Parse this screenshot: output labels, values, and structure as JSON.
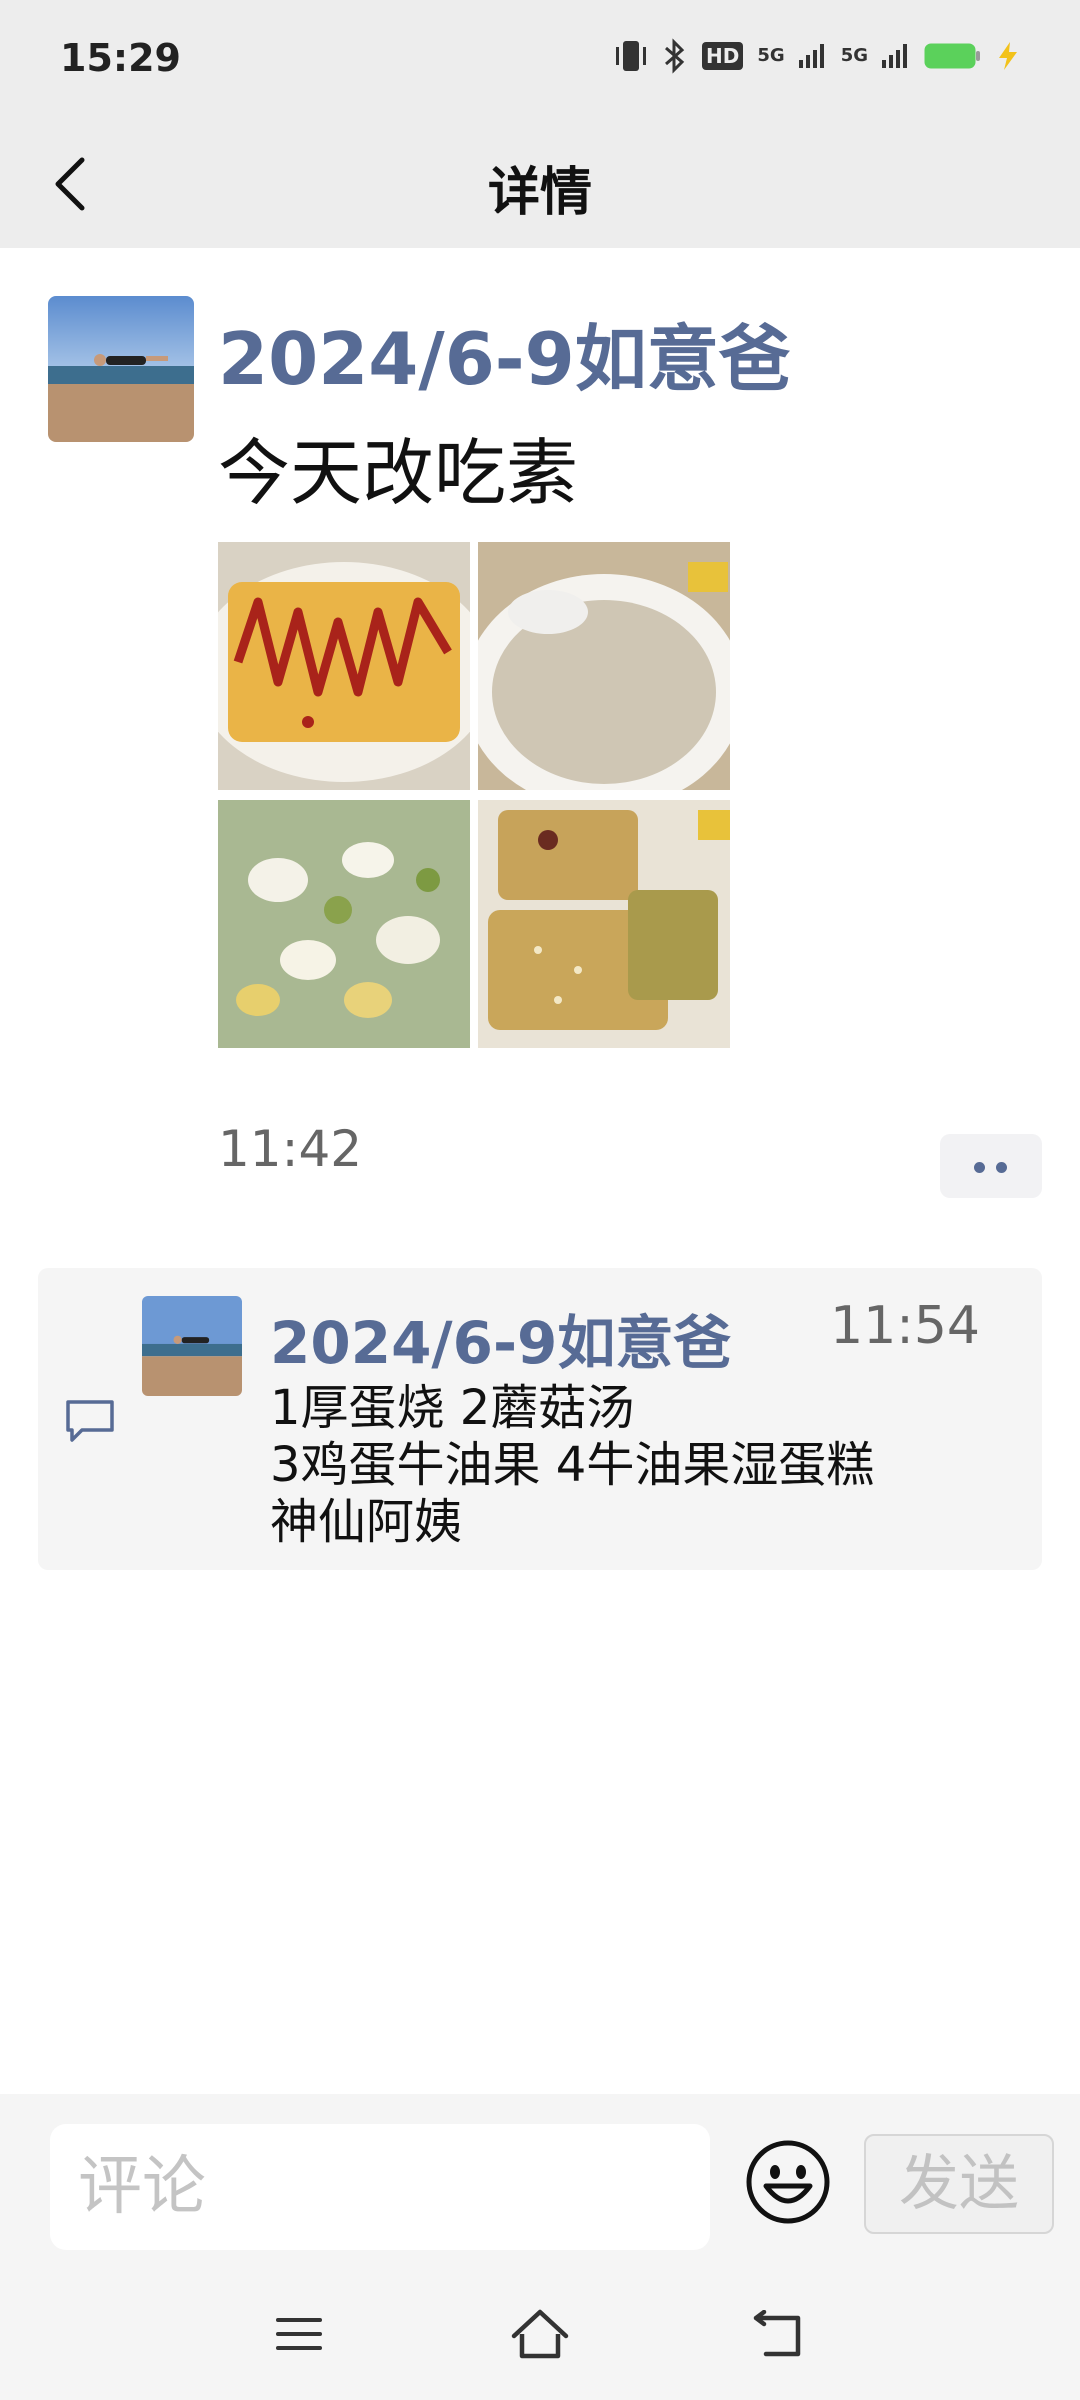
{
  "status": {
    "time": "15:29",
    "network_label": "HD",
    "signal_label": "5G"
  },
  "header": {
    "title": "详情"
  },
  "post": {
    "author": "2024/6-9如意爸",
    "text": "今天改吃素",
    "time": "11:42",
    "photos": [
      "omelette-roll-photo",
      "mushroom-soup-photo",
      "egg-avocado-salad-photo",
      "avocado-cake-photo"
    ]
  },
  "comment": {
    "author": "2024/6-9如意爸",
    "time": "11:54",
    "text": "1厚蛋烧 2蘑菇汤\n3鸡蛋牛油果 4牛油果湿蛋糕\n神仙阿姨"
  },
  "input": {
    "placeholder": "评论",
    "send_label": "发送"
  },
  "colors": {
    "name_color": "#576b95",
    "topbar_bg": "#ededed",
    "bottom_bg": "#f5f5f5"
  }
}
